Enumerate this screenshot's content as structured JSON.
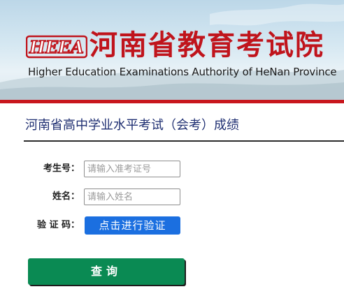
{
  "header": {
    "logo_text": "HEEA",
    "title_cn": "河南省教育考试院",
    "title_en": "Higher Education Examinations Authority of HeNan Province"
  },
  "page": {
    "section_title": "河南省高中学业水平考试（会考）成绩"
  },
  "form": {
    "exam_number": {
      "label": "考生号：",
      "value": "",
      "placeholder": "请输入准考证号"
    },
    "name": {
      "label": "姓名：",
      "value": "",
      "placeholder": "请输入姓名"
    },
    "captcha": {
      "label": "验 证 码：",
      "button_label": "点击进行验证"
    },
    "submit_label": "查询"
  },
  "colors": {
    "brand_red": "#c8161d",
    "title_blue": "#1f2f72",
    "captcha_blue": "#1b6fe0",
    "submit_green": "#0a8a53"
  }
}
